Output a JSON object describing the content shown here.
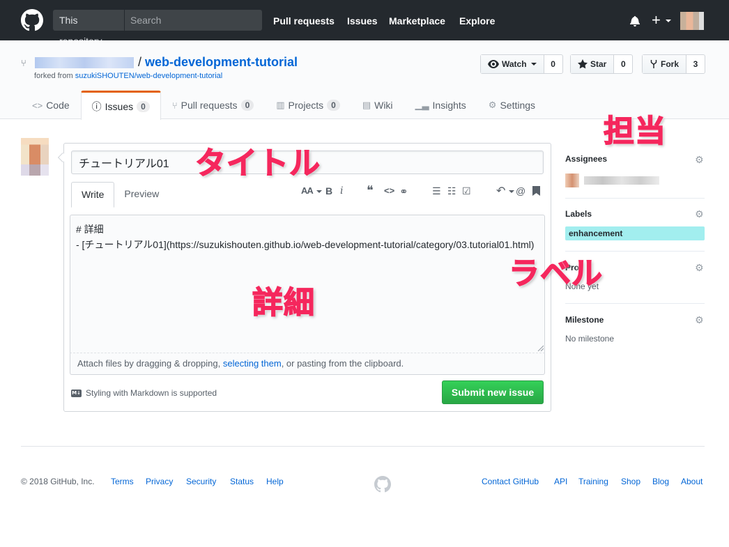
{
  "header": {
    "scope_label": "This repository",
    "search_placeholder": "Search",
    "nav": [
      "Pull requests",
      "Issues",
      "Marketplace",
      "Explore"
    ],
    "plus": "+"
  },
  "repo": {
    "slash": "/",
    "name": "web-development-tutorial",
    "forked_prefix": "forked from",
    "forked_link": "suzukiSHOUTEN/web-development-tutorial",
    "watch_label": "Watch",
    "watch_count": "0",
    "star_label": "Star",
    "star_count": "0",
    "fork_label": "Fork",
    "fork_count": "3"
  },
  "tabs": [
    {
      "label": "Code",
      "icon": "code-icon"
    },
    {
      "label": "Issues",
      "count": "0",
      "icon": "issue-opened-icon",
      "selected": true
    },
    {
      "label": "Pull requests",
      "count": "0",
      "icon": "git-pull-request-icon"
    },
    {
      "label": "Projects",
      "count": "0",
      "icon": "project-icon"
    },
    {
      "label": "Wiki",
      "icon": "book-icon"
    },
    {
      "label": "Insights",
      "icon": "graph-icon"
    },
    {
      "label": "Settings",
      "icon": "gear-icon"
    }
  ],
  "issue": {
    "title": "チュートリアル01",
    "write_tab": "Write",
    "preview_tab": "Preview",
    "body": "# 詳細\n- [チュートリアル01](https://suzukishouten.github.io/web-development-tutorial/category/03.tutorial01.html)",
    "attach_pre": "Attach files by dragging & dropping, ",
    "attach_link": "selecting them",
    "attach_post": ", or pasting from the clipboard.",
    "markdown_note": "Styling with Markdown is supported",
    "markdown_badge": "M↓",
    "submit": "Submit new issue",
    "toolbar": {
      "header": "AA",
      "bold": "B",
      "italic": "i",
      "quote": "❝",
      "code": "<>",
      "link": "⚭",
      "ul": "☰",
      "ol": "☷",
      "task": "☑",
      "reply": "↶",
      "mention": "@",
      "bookmark": "🔖"
    }
  },
  "sidebar": {
    "assignees_head": "Assignees",
    "labels_head": "Labels",
    "label_name": "enhancement",
    "label_color": "#a2eeef",
    "projects_head": "Pro",
    "projects_value": "None yet",
    "milestone_head": "Milestone",
    "milestone_value": "No milestone"
  },
  "annotations": {
    "title": "タイトル",
    "detail": "詳細",
    "label": "ラベル",
    "assignee": "担当",
    "color": "#f5275d"
  },
  "footer": {
    "copyright": "© 2018 GitHub, Inc.",
    "left_links": [
      "Terms",
      "Privacy",
      "Security",
      "Status",
      "Help"
    ],
    "right_links": [
      "Contact GitHub",
      "API",
      "Training",
      "Shop",
      "Blog",
      "About"
    ]
  }
}
